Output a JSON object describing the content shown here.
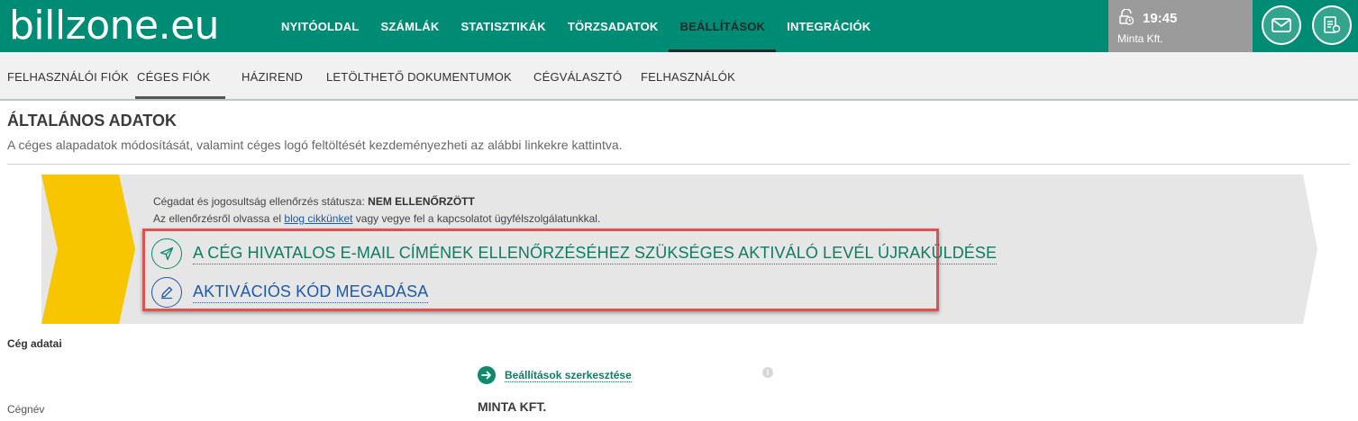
{
  "header": {
    "logo_text": "billzone.eu",
    "nav": [
      "NYITÓOLDAL",
      "SZÁMLÁK",
      "STATISZTIKÁK",
      "TÖRZSADATOK",
      "BEÁLLÍTÁSOK",
      "INTEGRÁCIÓK"
    ],
    "active_nav": "BEÁLLÍTÁSOK",
    "time": "19:45",
    "company": "Minta Kft.",
    "icons": [
      "timer-icon",
      "mail-icon",
      "notes-icon"
    ],
    "brand_color": "#008c74"
  },
  "subnav": {
    "items": [
      "FELHASZNÁLÓI FIÓK",
      "CÉGES FIÓK",
      "HÁZIREND",
      "LETÖLTHETŐ DOKUMENTUMOK",
      "CÉGVÁLASZTÓ",
      "FELHASZNÁLÓK"
    ],
    "active": "CÉGES FIÓK"
  },
  "section": {
    "title": "ÁLTALÁNOS ADATOK",
    "description": "A céges alapadatok módosítását, valamint céges logó feltöltését kezdeményezheti az alábbi linkekre kattintva."
  },
  "banner": {
    "status_prefix": "Cégadat és jogosultság ellenőrzés státusza: ",
    "status_value": "NEM ELLENŐRZÖTT",
    "info_prefix": "Az ellenőrzésről olvassa el ",
    "info_link": "blog cikkünket",
    "info_suffix": " vagy vegye fel a kapcsolatot ügyfélszolgálatunkkal.",
    "action_resend": "A CÉG HIVATALOS E-MAIL CÍMÉNEK ELLENŐRZÉSÉHEZ SZÜKSÉGES AKTIVÁLÓ LEVÉL ÚJRAKÜLDÉSE",
    "action_code": "AKTIVÁCIÓS KÓD MEGADÁSA",
    "accent_yellow": "#f7c600",
    "highlight_color": "#e0534c"
  },
  "company": {
    "heading": "Cég adatai",
    "edit_link": "Beállítások szerkesztése",
    "info_glyph": "i",
    "fields": [
      {
        "label": "Cégnév",
        "value": "MINTA KFT."
      }
    ]
  }
}
